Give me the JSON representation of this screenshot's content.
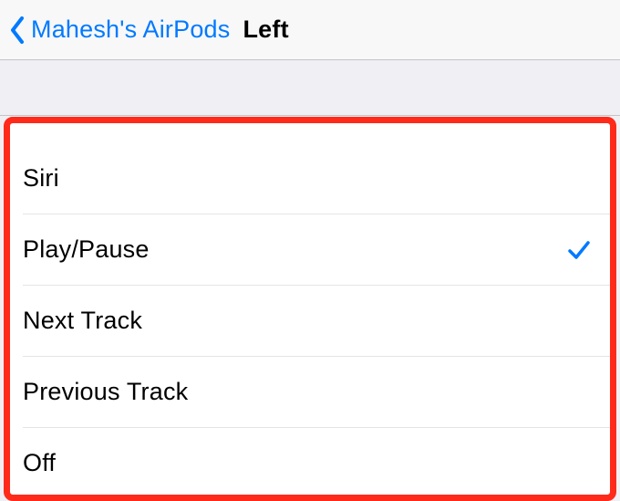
{
  "nav": {
    "back_label": "Mahesh's AirPods",
    "title": "Left"
  },
  "options": [
    {
      "label": "Siri",
      "selected": false
    },
    {
      "label": "Play/Pause",
      "selected": true
    },
    {
      "label": "Next Track",
      "selected": false
    },
    {
      "label": "Previous Track",
      "selected": false
    },
    {
      "label": "Off",
      "selected": false
    }
  ]
}
